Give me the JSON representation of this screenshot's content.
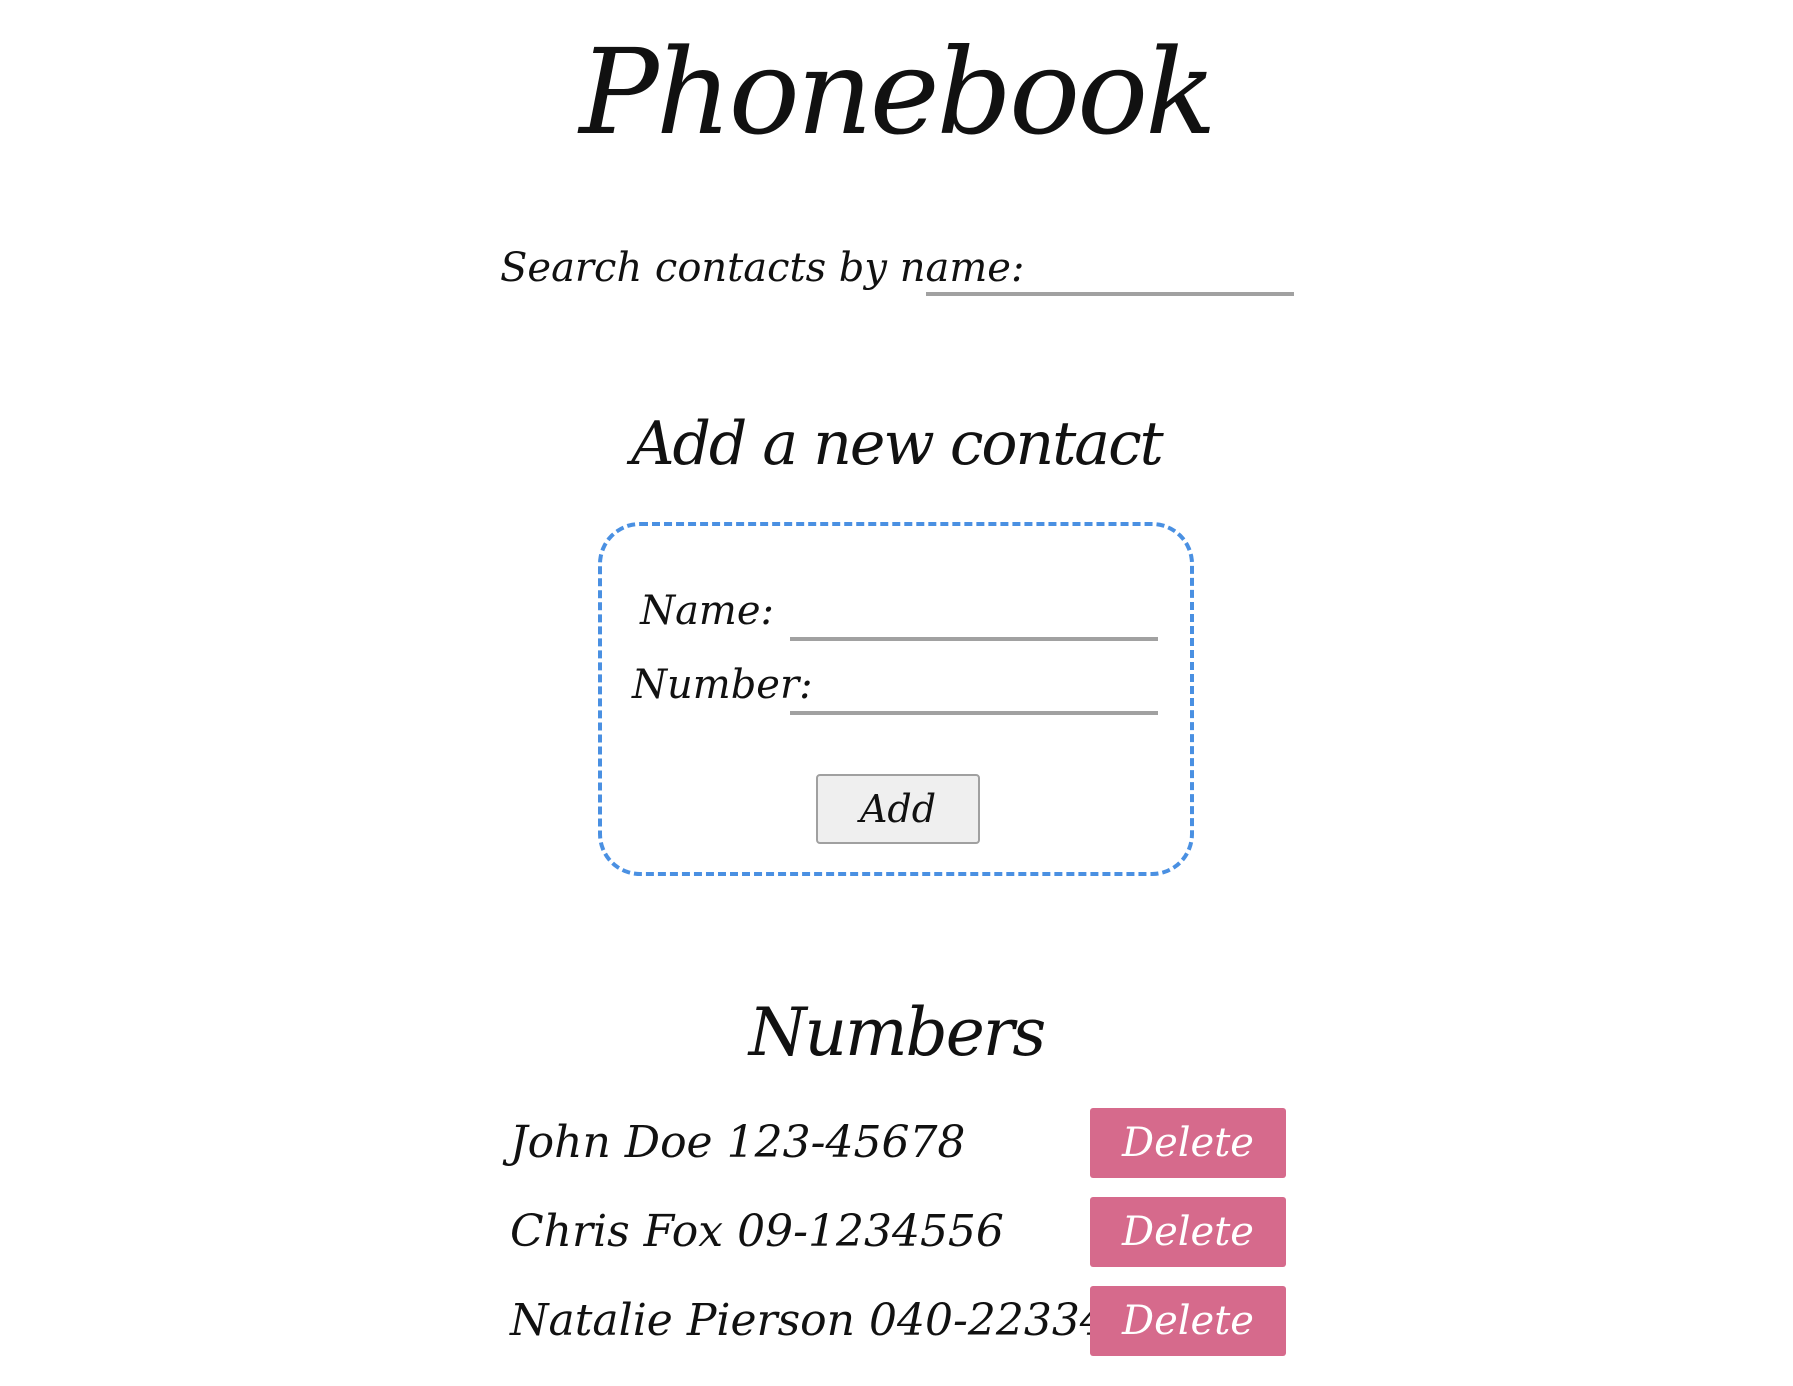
{
  "app": {
    "title": "Phonebook"
  },
  "search": {
    "label": "Search contacts by name:",
    "value": ""
  },
  "add_contact": {
    "heading": "Add a new contact",
    "name_label": "Name:",
    "name_value": "",
    "number_label": "Number:",
    "number_value": "",
    "add_button_label": "Add"
  },
  "numbers": {
    "heading": "Numbers",
    "delete_label": "Delete",
    "contacts": [
      {
        "name": "John Doe",
        "number": "123-45678"
      },
      {
        "name": "Chris Fox",
        "number": "09-1234556"
      },
      {
        "name": "Natalie Pierson",
        "number": "040-22334455"
      }
    ]
  },
  "colors": {
    "text": "#111111",
    "input_underline": "#a1a1a1",
    "form_border": "#4a90e2",
    "add_button_bg": "#efefef",
    "delete_button_bg": "#d66a8c",
    "delete_button_text": "#ffffff"
  }
}
